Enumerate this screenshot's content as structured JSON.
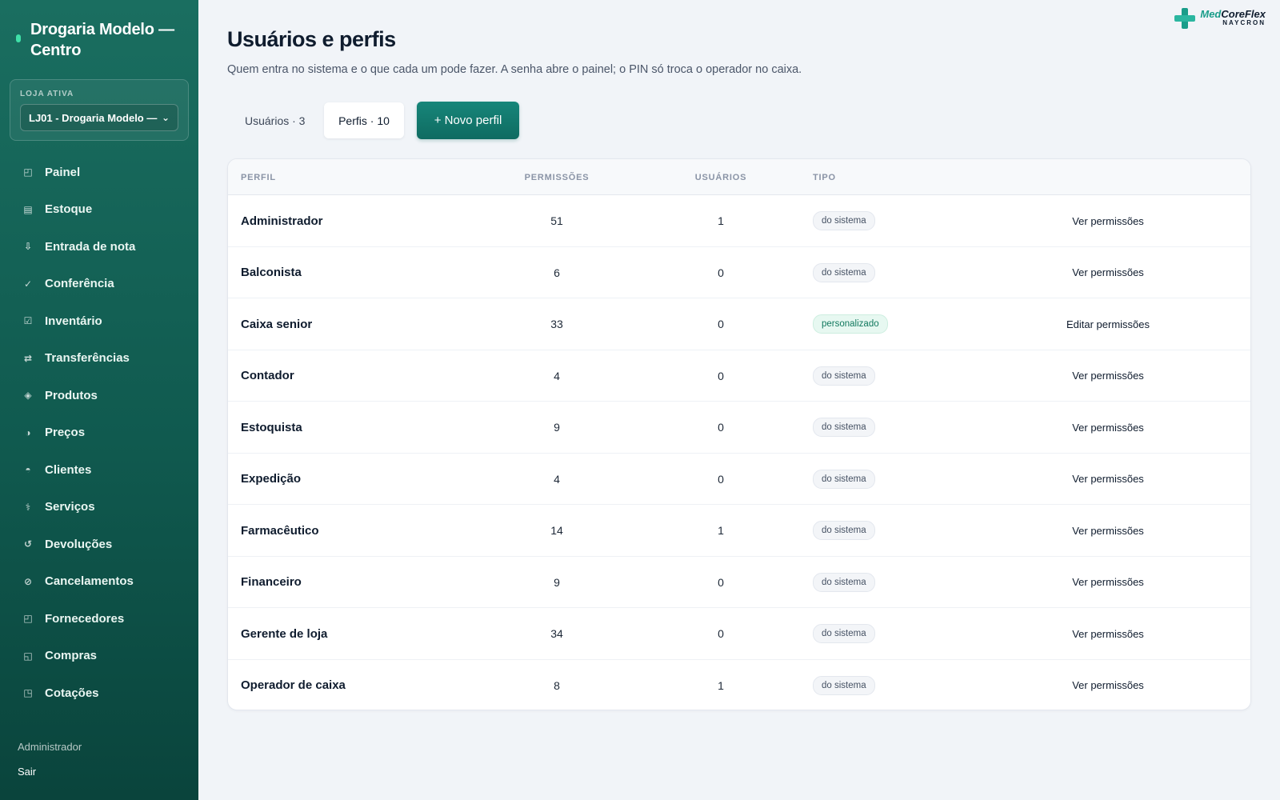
{
  "sidebar": {
    "brand": "Drogaria Modelo — Centro",
    "store_label": "LOJA ATIVA",
    "store_value": "LJ01 - Drogaria Modelo —",
    "items": [
      {
        "label": "Painel",
        "icon": "◰"
      },
      {
        "label": "Estoque",
        "icon": "▤"
      },
      {
        "label": "Entrada de nota",
        "icon": "⇩"
      },
      {
        "label": "Conferência",
        "icon": "✓"
      },
      {
        "label": "Inventário",
        "icon": "☑"
      },
      {
        "label": "Transferências",
        "icon": "⇄"
      },
      {
        "label": "Produtos",
        "icon": "◈"
      },
      {
        "label": "Preços",
        "icon": "◑"
      },
      {
        "label": "Clientes",
        "icon": "◓"
      },
      {
        "label": "Serviços",
        "icon": "⚕"
      },
      {
        "label": "Devoluções",
        "icon": "↺"
      },
      {
        "label": "Cancelamentos",
        "icon": "⊘"
      },
      {
        "label": "Fornecedores",
        "icon": "◰"
      },
      {
        "label": "Compras",
        "icon": "◱"
      },
      {
        "label": "Cotações",
        "icon": "◳"
      }
    ],
    "role": "Administrador",
    "exit": "Sair"
  },
  "logo": {
    "name_a": "Med",
    "name_b": "CoreFlex",
    "sub": "NAYCRON"
  },
  "header": {
    "title": "Usuários e perfis",
    "subtitle": "Quem entra no sistema e o que cada um pode fazer. A senha abre o painel; o PIN só troca o operador no caixa."
  },
  "tabs": {
    "users": "Usuários · 3",
    "profiles": "Perfis · 10"
  },
  "new_profile_button": "+ Novo perfil",
  "table": {
    "headers": {
      "profile": "PERFIL",
      "permissions": "PERMISSÕES",
      "users": "USUÁRIOS",
      "type": "TIPO"
    },
    "rows": [
      {
        "name": "Administrador",
        "permissions": "51",
        "users": "1",
        "type": "do sistema",
        "custom": false,
        "action": "Ver permissões"
      },
      {
        "name": "Balconista",
        "permissions": "6",
        "users": "0",
        "type": "do sistema",
        "custom": false,
        "action": "Ver permissões"
      },
      {
        "name": "Caixa senior",
        "permissions": "33",
        "users": "0",
        "type": "personalizado",
        "custom": true,
        "action": "Editar permissões"
      },
      {
        "name": "Contador",
        "permissions": "4",
        "users": "0",
        "type": "do sistema",
        "custom": false,
        "action": "Ver permissões"
      },
      {
        "name": "Estoquista",
        "permissions": "9",
        "users": "0",
        "type": "do sistema",
        "custom": false,
        "action": "Ver permissões"
      },
      {
        "name": "Expedição",
        "permissions": "4",
        "users": "0",
        "type": "do sistema",
        "custom": false,
        "action": "Ver permissões"
      },
      {
        "name": "Farmacêutico",
        "permissions": "14",
        "users": "1",
        "type": "do sistema",
        "custom": false,
        "action": "Ver permissões"
      },
      {
        "name": "Financeiro",
        "permissions": "9",
        "users": "0",
        "type": "do sistema",
        "custom": false,
        "action": "Ver permissões"
      },
      {
        "name": "Gerente de loja",
        "permissions": "34",
        "users": "0",
        "type": "do sistema",
        "custom": false,
        "action": "Ver permissões"
      },
      {
        "name": "Operador de caixa",
        "permissions": "8",
        "users": "1",
        "type": "do sistema",
        "custom": false,
        "action": "Ver permissões"
      }
    ]
  }
}
